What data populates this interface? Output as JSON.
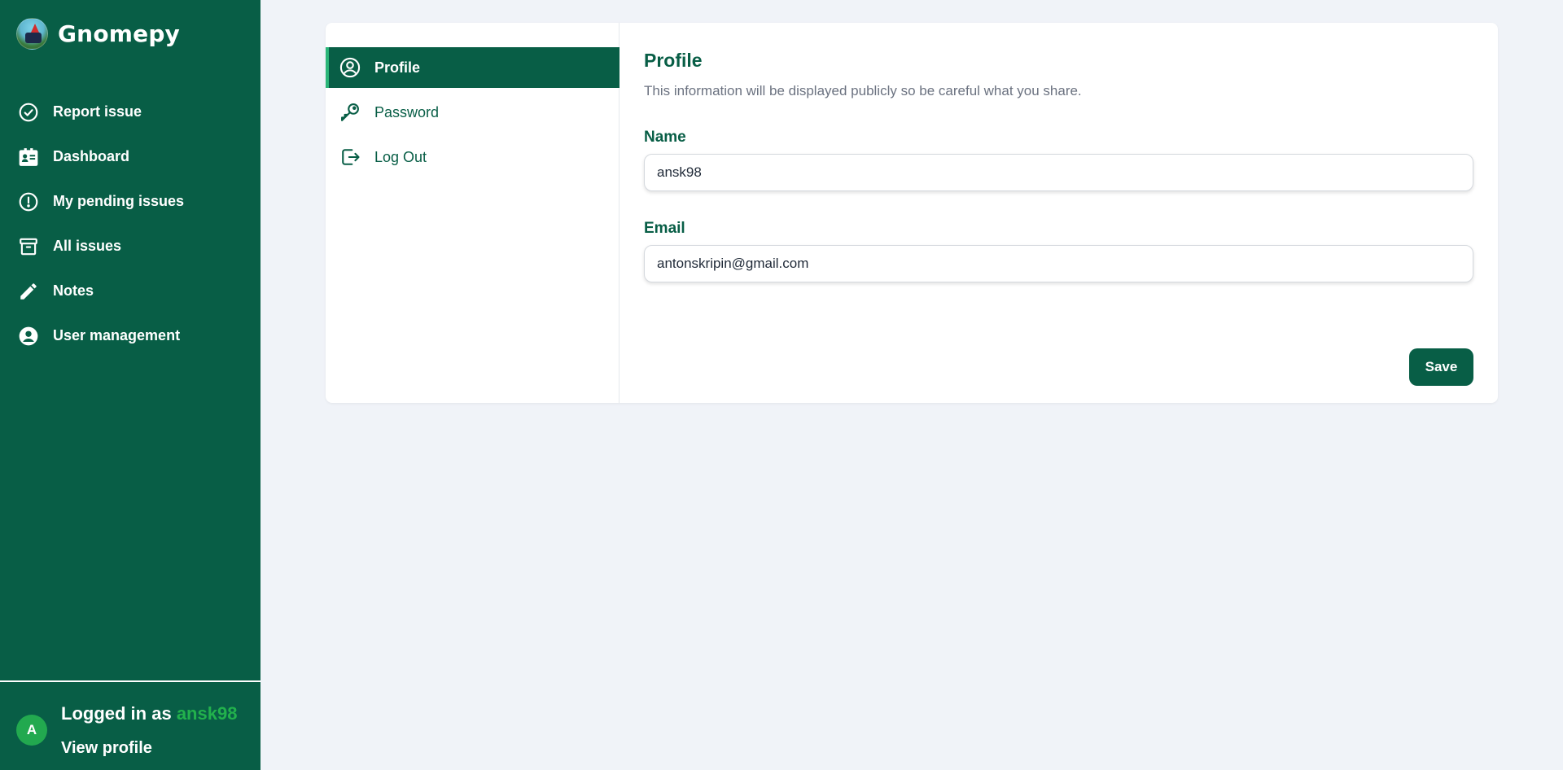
{
  "app": {
    "name": "Gnomepy"
  },
  "sidebar": {
    "items": [
      {
        "label": "Report issue",
        "icon": "check-circle-icon"
      },
      {
        "label": "Dashboard",
        "icon": "id-card-icon"
      },
      {
        "label": "My pending issues",
        "icon": "exclamation-circle-icon"
      },
      {
        "label": "All issues",
        "icon": "archive-box-icon"
      },
      {
        "label": "Notes",
        "icon": "pencil-icon"
      },
      {
        "label": "User management",
        "icon": "user-circle-icon"
      }
    ],
    "footer": {
      "avatar_initial": "A",
      "logged_in_prefix": "Logged in as",
      "username": "ansk98",
      "view_profile": "View profile"
    }
  },
  "settings_nav": {
    "items": [
      {
        "label": "Profile",
        "icon": "user-circle-outline-icon",
        "active": true
      },
      {
        "label": "Password",
        "icon": "key-icon",
        "active": false
      },
      {
        "label": "Log Out",
        "icon": "logout-icon",
        "active": false
      }
    ]
  },
  "profile": {
    "title": "Profile",
    "description": "This information will be displayed publicly so be careful what you share.",
    "name_label": "Name",
    "name_value": "ansk98",
    "email_label": "Email",
    "email_value": "antonskripin@gmail.com",
    "save_label": "Save"
  },
  "colors": {
    "primary": "#085e46",
    "accent_green": "#22b14c",
    "background": "#f0f3f8"
  }
}
